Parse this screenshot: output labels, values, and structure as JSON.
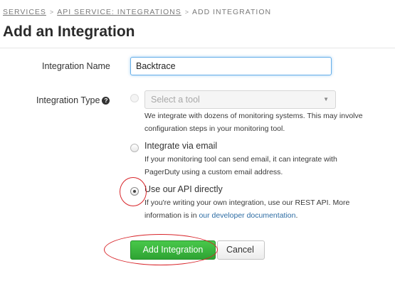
{
  "breadcrumb": {
    "items": [
      "SERVICES",
      "API SERVICE: INTEGRATIONS",
      "ADD INTEGRATION"
    ],
    "separator": ">"
  },
  "page": {
    "title": "Add an Integration"
  },
  "form": {
    "name_label": "Integration Name",
    "name_value": "Backtrace",
    "type_label": "Integration Type",
    "help_icon": "question-circle-icon",
    "options": [
      {
        "label": "Select a tool",
        "help": [
          "We integrate with dozens of monitoring systems. This may involve",
          "configuration steps in your monitoring tool."
        ],
        "selected": false
      },
      {
        "label": "Integrate via email",
        "help": [
          "If your monitoring tool can send email, it can integrate with",
          "PagerDuty using a custom email address."
        ],
        "selected": false
      },
      {
        "label": "Use our API directly",
        "help_line1": "If you're writing your own integration, use our REST API. More",
        "help_line2_prefix": "information is in ",
        "help_link": "our developer documentation",
        "help_line2_suffix": ".",
        "selected": true
      }
    ]
  },
  "actions": {
    "submit_label": "Add Integration",
    "cancel_label": "Cancel"
  },
  "colors": {
    "primary_button": "#36b43a",
    "link": "#2e6da4",
    "annotation": "#d8252a"
  }
}
